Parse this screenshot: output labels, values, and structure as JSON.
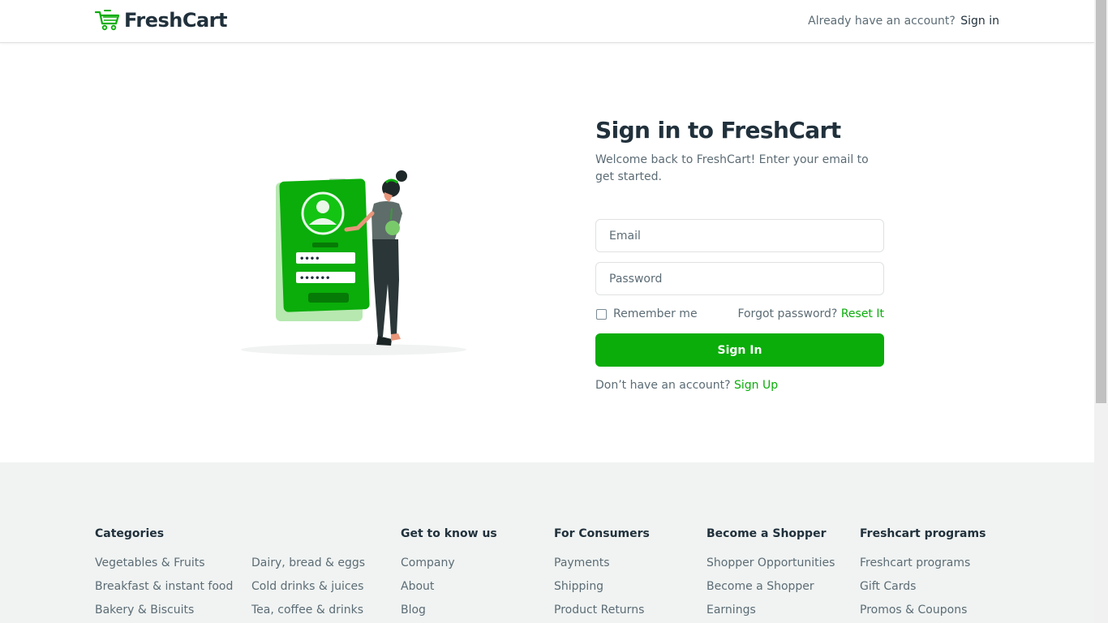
{
  "header": {
    "logo_text": "FreshCart",
    "account_prompt": "Already have an account?",
    "sign_in_link": "Sign in"
  },
  "signin_form": {
    "title": "Sign in to FreshCart",
    "subtitle": "Welcome back to FreshCart! Enter your email to get started.",
    "email_placeholder": "Email",
    "password_placeholder": "Password",
    "remember_label": "Remember me",
    "forgot_text": "Forgot password?",
    "reset_link": "Reset It",
    "submit_label": "Sign In",
    "no_account_text": "Don’t have an account?",
    "signup_link": "Sign Up"
  },
  "illustration": {
    "pin_dots": "••••",
    "password_dots": "••••••"
  },
  "footer": {
    "categories": {
      "heading": "Categories",
      "col1": [
        "Vegetables & Fruits",
        "Breakfast & instant food",
        "Bakery & Biscuits"
      ],
      "col2": [
        "Dairy, bread & eggs",
        "Cold drinks & juices",
        "Tea, coffee & drinks"
      ]
    },
    "get_to_know": {
      "heading": "Get to know us",
      "links": [
        "Company",
        "About",
        "Blog"
      ]
    },
    "for_consumers": {
      "heading": "For Consumers",
      "links": [
        "Payments",
        "Shipping",
        "Product Returns"
      ]
    },
    "become_shopper": {
      "heading": "Become a Shopper",
      "links": [
        "Shopper Opportunities",
        "Become a Shopper",
        "Earnings"
      ]
    },
    "programs": {
      "heading": "Freshcart programs",
      "links": [
        "Freshcart programs",
        "Gift Cards",
        "Promos & Coupons"
      ]
    }
  },
  "colors": {
    "brand_green": "#0aad0a",
    "heading_dark": "#21313c",
    "body_text": "#5c6c75",
    "footer_bg": "#f0f3f2"
  }
}
